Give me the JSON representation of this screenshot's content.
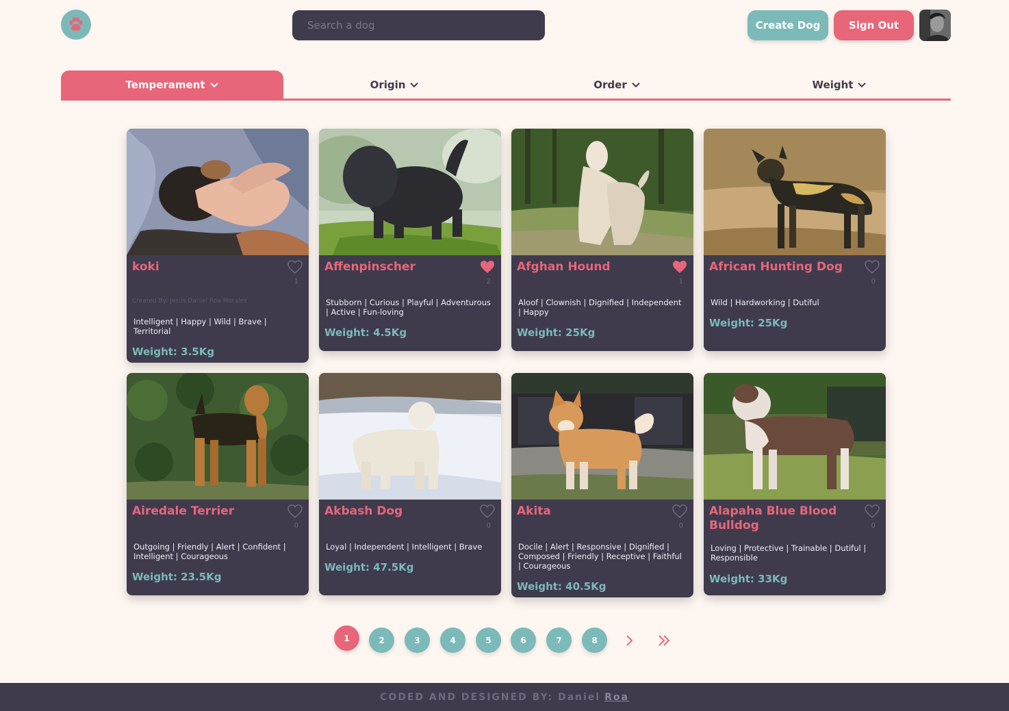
{
  "header": {
    "search_placeholder": "Search a dog",
    "create_label": "Create Dog",
    "signout_label": "Sign Out"
  },
  "filters": [
    {
      "label": "Temperament",
      "active": true
    },
    {
      "label": "Origin",
      "active": false
    },
    {
      "label": "Order",
      "active": false
    },
    {
      "label": "Weight",
      "active": false
    }
  ],
  "cards": [
    {
      "name": "koki",
      "likes": "1",
      "liked": false,
      "creator": "Created By: Jesús Daniel Roa Morales",
      "temperament": "Intelligent | Happy | Wild | Brave | Territorial",
      "weight": "Weight: 3.5Kg",
      "photo": "puppy"
    },
    {
      "name": "Affenpinscher",
      "likes": "2",
      "liked": true,
      "creator": "",
      "temperament": "Stubborn | Curious | Playful | Adventurous | Active | Fun-loving",
      "weight": "Weight: 4.5Kg",
      "photo": "black-shaggy"
    },
    {
      "name": "Afghan Hound",
      "likes": "1",
      "liked": true,
      "creator": "",
      "temperament": "Aloof | Clownish | Dignified | Independent | Happy",
      "weight": "Weight: 25Kg",
      "photo": "cream-longhair"
    },
    {
      "name": "African Hunting Dog",
      "likes": "0",
      "liked": false,
      "creator": "",
      "temperament": "Wild | Hardworking | Dutiful",
      "weight": "Weight: 25Kg",
      "photo": "wild-dog"
    },
    {
      "name": "Airedale Terrier",
      "likes": "0",
      "liked": false,
      "creator": "",
      "temperament": "Outgoing | Friendly | Alert | Confident | Intelligent | Courageous",
      "weight": "Weight: 23.5Kg",
      "photo": "terrier"
    },
    {
      "name": "Akbash Dog",
      "likes": "0",
      "liked": false,
      "creator": "",
      "temperament": "Loyal | Independent | Intelligent | Brave",
      "weight": "Weight: 47.5Kg",
      "photo": "white-snow"
    },
    {
      "name": "Akita",
      "likes": "0",
      "liked": false,
      "creator": "",
      "temperament": "Docile | Alert | Responsive | Dignified | Composed | Friendly | Receptive | Faithful | Courageous",
      "weight": "Weight: 40.5Kg",
      "photo": "akita"
    },
    {
      "name": "Alapaha Blue Blood Bulldog",
      "likes": "0",
      "liked": false,
      "creator": "",
      "temperament": "Loving | Protective | Trainable | Dutiful | Responsible",
      "weight": "Weight: 33Kg",
      "photo": "bulldog"
    }
  ],
  "pagination": {
    "pages": [
      "1",
      "2",
      "3",
      "4",
      "5",
      "6",
      "7",
      "8"
    ],
    "current": "1"
  },
  "footer": {
    "prefix": "CODED AND DESIGNED BY: Daniel",
    "link": "Roa"
  },
  "colors": {
    "accent_pink": "#e8667a",
    "accent_teal": "#7bbab9",
    "card_bg": "#3f3b4d",
    "page_bg": "#fdf6f1"
  }
}
